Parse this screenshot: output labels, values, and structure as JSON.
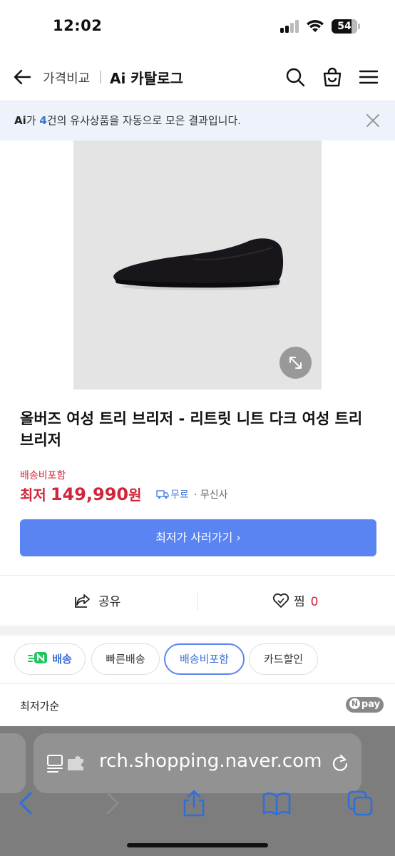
{
  "status": {
    "time": "12:02",
    "battery": "54"
  },
  "nav": {
    "breadcrumb": "가격비교",
    "title": "Ai 카탈로그"
  },
  "banner": {
    "ai": "Ai",
    "prefix": "가 ",
    "count": "4",
    "suffix": "건의 유사상품을 자동으로 모은 결과입니다."
  },
  "product": {
    "title": "올버즈 여성 트리 브리저 - 리트릿 니트 다크 여성 트리 브리저",
    "shipping_included": "배송비포함",
    "price_label": "최저",
    "price": "149,990",
    "price_unit": "원",
    "shipping": "무료",
    "seller": "· 무신사",
    "buy_label": "최저가 사러가기 ›"
  },
  "actions": {
    "share": "공유",
    "like": "찜",
    "like_count": "0"
  },
  "chips": [
    {
      "label": "배송"
    },
    {
      "label": "빠른배송"
    },
    {
      "label": "배송비포함"
    },
    {
      "label": "카드할인"
    }
  ],
  "sort": {
    "label": "최저가순",
    "badge": "pay"
  },
  "browser": {
    "url": "rch.shopping.naver.com"
  },
  "colors": {
    "accent": "#5a84f2",
    "price_red": "#d0263c",
    "banner_bg": "#eef3fb"
  }
}
